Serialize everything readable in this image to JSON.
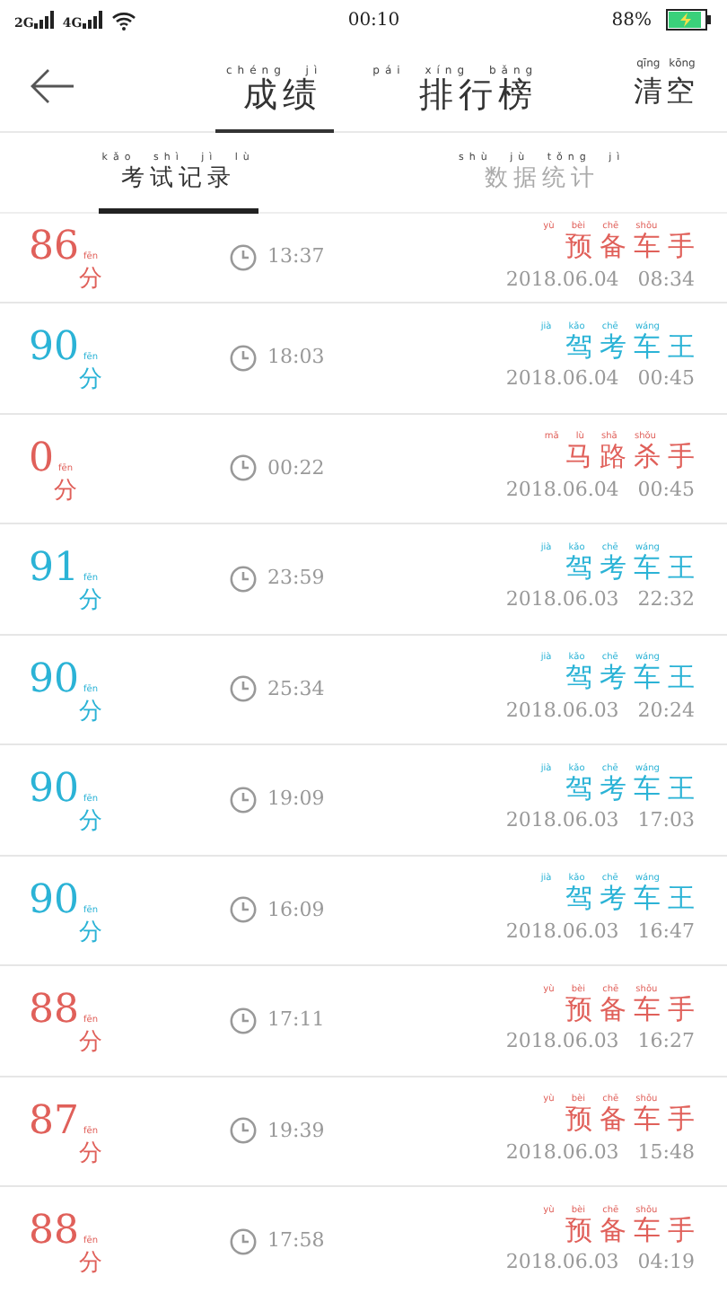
{
  "status_bar": {
    "signal_1": "2G",
    "signal_2": "4G",
    "time": "00:10",
    "battery": "88%",
    "charging": true
  },
  "header": {
    "tabs": [
      {
        "label": "成绩",
        "pinyin": "chéng jì",
        "selected": true
      },
      {
        "label": "排行榜",
        "pinyin": "pái xíng bǎng",
        "selected": false
      }
    ],
    "action": {
      "label": "清空",
      "pinyin": "qīng kōng"
    }
  },
  "subtabs": [
    {
      "label": "考试记录",
      "pinyin": "kǎo shì jì lù",
      "selected": true
    },
    {
      "label": "数据统计",
      "pinyin": "shù jù tǒng jì",
      "selected": false
    }
  ],
  "records": [
    {
      "score": "86",
      "unit": "分",
      "unit_pinyin": "fēn",
      "duration": "13:37",
      "rank": "预备车手",
      "rank_pinyin": "yù bèi chē shǒu",
      "date": "2018.06.04",
      "time": "08:34",
      "color": "#e0605a"
    },
    {
      "score": "90",
      "unit": "分",
      "unit_pinyin": "fēn",
      "duration": "18:03",
      "rank": "驾考车王",
      "rank_pinyin": "jià kǎo chē wáng",
      "date": "2018.06.04",
      "time": "00:45",
      "color": "#2bb3d6"
    },
    {
      "score": "0",
      "unit": "分",
      "unit_pinyin": "fēn",
      "duration": "00:22",
      "rank": "马路杀手",
      "rank_pinyin": "mǎ lù shā shǒu",
      "date": "2018.06.04",
      "time": "00:45",
      "color": "#e0605a"
    },
    {
      "score": "91",
      "unit": "分",
      "unit_pinyin": "fēn",
      "duration": "23:59",
      "rank": "驾考车王",
      "rank_pinyin": "jià kǎo chē wáng",
      "date": "2018.06.03",
      "time": "22:32",
      "color": "#2bb3d6"
    },
    {
      "score": "90",
      "unit": "分",
      "unit_pinyin": "fēn",
      "duration": "25:34",
      "rank": "驾考车王",
      "rank_pinyin": "jià kǎo chē wáng",
      "date": "2018.06.03",
      "time": "20:24",
      "color": "#2bb3d6"
    },
    {
      "score": "90",
      "unit": "分",
      "unit_pinyin": "fēn",
      "duration": "19:09",
      "rank": "驾考车王",
      "rank_pinyin": "jià kǎo chē wáng",
      "date": "2018.06.03",
      "time": "17:03",
      "color": "#2bb3d6"
    },
    {
      "score": "90",
      "unit": "分",
      "unit_pinyin": "fēn",
      "duration": "16:09",
      "rank": "驾考车王",
      "rank_pinyin": "jià kǎo chē wáng",
      "date": "2018.06.03",
      "time": "16:47",
      "color": "#2bb3d6"
    },
    {
      "score": "88",
      "unit": "分",
      "unit_pinyin": "fēn",
      "duration": "17:11",
      "rank": "预备车手",
      "rank_pinyin": "yù bèi chē shǒu",
      "date": "2018.06.03",
      "time": "16:27",
      "color": "#e0605a"
    },
    {
      "score": "87",
      "unit": "分",
      "unit_pinyin": "fēn",
      "duration": "19:39",
      "rank": "预备车手",
      "rank_pinyin": "yù bèi chē shǒu",
      "date": "2018.06.03",
      "time": "15:48",
      "color": "#e0605a"
    },
    {
      "score": "88",
      "unit": "分",
      "unit_pinyin": "fēn",
      "duration": "17:58",
      "rank": "预备车手",
      "rank_pinyin": "yù bèi chē shǒu",
      "date": "2018.06.03",
      "time": "04:19",
      "color": "#e0605a"
    }
  ]
}
